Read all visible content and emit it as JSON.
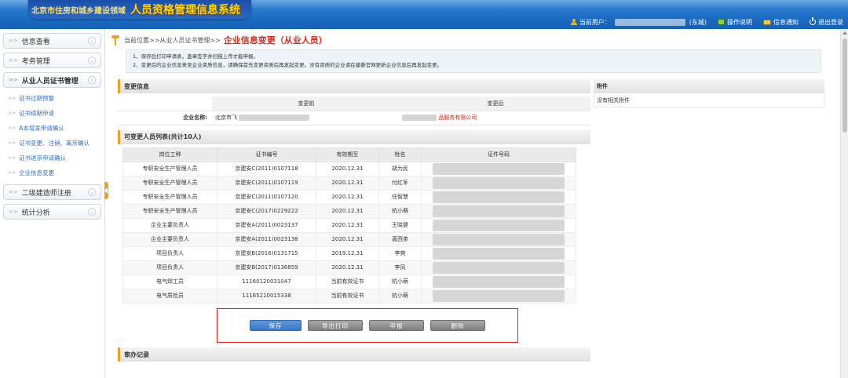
{
  "header": {
    "org": "北京市住房和城乡建设领域",
    "system": "人员资格管理信息系统",
    "current_user_label": "当前用户：",
    "current_user_suffix": "(东城)",
    "help": "操作说明",
    "notify": "信息通知",
    "logout": "退出登录"
  },
  "sidebar": {
    "groups": [
      {
        "label": "信息查看"
      },
      {
        "label": "考务管理"
      },
      {
        "label": "从业人员证书管理"
      },
      {
        "label": "二级建造师注册"
      },
      {
        "label": "统计分析"
      }
    ],
    "subitems": [
      {
        "label": "证书过期预警"
      },
      {
        "label": "证书续期申请"
      },
      {
        "label": "A本增发申请确认"
      },
      {
        "label": "证书变更、注销、离京确认"
      },
      {
        "label": "证书进京申请确认"
      },
      {
        "label": "企业信息变更"
      }
    ]
  },
  "breadcrumb": {
    "prefix": "当前位置>>从业人员证书管理>>",
    "current": "企业信息变更（从业人员）"
  },
  "notice": {
    "line1": "1、保存后打印申请表，盖章签字并扫描上传才能申报。",
    "line2": "2、变更后的企业信息来至企业资质信息，请确保首先变更资质后再发起变更。没有资质的企业请在建委官网更新企业信息后再发起变更。"
  },
  "change_info": {
    "title": "变更信息",
    "col_before": "变更前",
    "col_after": "变更后",
    "row_label": "企业名称:",
    "before_prefix": "北京市飞",
    "after_suffix": "品服务有限公司"
  },
  "staff": {
    "title": "可变更人员列表(共计10人)",
    "columns": [
      "岗位工种",
      "证书编号",
      "有效期至",
      "姓名",
      "证件号码"
    ],
    "rows": [
      {
        "job": "专职安全生产管理人员",
        "cert": "京建安C(2011)0107118",
        "expiry": "2020.12.31",
        "name": "胡为民"
      },
      {
        "job": "专职安全生产管理人员",
        "cert": "京建安C(2011)0107119",
        "expiry": "2020.12.31",
        "name": "付红军"
      },
      {
        "job": "专职安全生产管理人员",
        "cert": "京建安C(2011)0107120",
        "expiry": "2020.12.31",
        "name": "任智慧"
      },
      {
        "job": "专职安全生产管理人员",
        "cert": "京建安C(2017)0229222",
        "expiry": "2020.12.31",
        "name": "杭小萌"
      },
      {
        "job": "企业主要负责人",
        "cert": "京建安A(2011)0023137",
        "expiry": "2020.12.31",
        "name": "王晓健"
      },
      {
        "job": "企业主要负责人",
        "cert": "京建安A(2011)0023138",
        "expiry": "2020.12.31",
        "name": "唐西茶"
      },
      {
        "job": "项目负责人",
        "cert": "京建安B(2016)0131715",
        "expiry": "2019.12.31",
        "name": "李爽"
      },
      {
        "job": "项目负责人",
        "cert": "京建安B(2017)0136859",
        "expiry": "2020.12.31",
        "name": "李凤"
      },
      {
        "job": "电气焊工员",
        "cert": "11160120031047",
        "expiry": "当前有效证书",
        "name": "杭小萌"
      },
      {
        "job": "电气质检员",
        "cert": "11165210015338",
        "expiry": "当前有效证书",
        "name": "杭小萌"
      }
    ]
  },
  "buttons": {
    "save": "保存",
    "export": "导出打印",
    "submit": "申报",
    "delete": "删除"
  },
  "audit": {
    "title": "审办记录"
  },
  "attachments": {
    "title": "附件",
    "empty": "没有相关附件"
  },
  "colors": {
    "accent": "#f0a020",
    "header": "#1c6cc4",
    "alert": "#d8281c"
  }
}
